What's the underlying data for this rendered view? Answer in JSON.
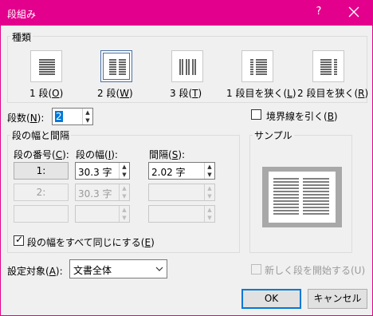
{
  "window": {
    "title": "段組み",
    "help": "?",
    "close": "close"
  },
  "presets": {
    "group_label": "種類",
    "items": [
      {
        "label_prefix": "1 段(",
        "key": "O",
        "label_suffix": ")"
      },
      {
        "label_prefix": "2 段(",
        "key": "W",
        "label_suffix": ")"
      },
      {
        "label_prefix": "3 段(",
        "key": "T",
        "label_suffix": ")"
      },
      {
        "label_prefix": "1 段目を狭く(",
        "key": "L",
        "label_suffix": ")"
      },
      {
        "label_prefix": "2 段目を狭く(",
        "key": "R",
        "label_suffix": ")"
      }
    ]
  },
  "columns": {
    "label_prefix": "段数(",
    "key": "N",
    "label_suffix": "):",
    "value": "2"
  },
  "line_between": {
    "label_prefix": "境界線を引く(",
    "key": "B",
    "label_suffix": ")",
    "checked": false
  },
  "width_spacing": {
    "group_label": "段の幅と間隔",
    "col_header_prefix": "段の番号(",
    "col_header_key": "C",
    "col_header_suffix": "):",
    "width_header_prefix": "段の幅(",
    "width_header_key": "I",
    "width_header_suffix": "):",
    "spacing_header_prefix": "間隔(",
    "spacing_header_key": "S",
    "spacing_header_suffix": "):",
    "rows": [
      {
        "num": "1:",
        "width": "30.3 字",
        "spacing": "2.02 字"
      },
      {
        "num": "2:",
        "width": "30.3 字",
        "spacing": ""
      },
      {
        "num": "",
        "width": "",
        "spacing": ""
      }
    ],
    "equal_width": {
      "label_prefix": "段の幅をすべて同じにする(",
      "key": "E",
      "label_suffix": ")",
      "checked": true
    }
  },
  "preview": {
    "group_label": "サンプル"
  },
  "apply_to": {
    "label_prefix": "設定対象(",
    "key": "A",
    "label_suffix": "):",
    "value": "文書全体"
  },
  "new_column": {
    "label": "新しく段を開始する(U)",
    "checked": false
  },
  "buttons": {
    "ok": "OK",
    "cancel": "キャンセル"
  }
}
